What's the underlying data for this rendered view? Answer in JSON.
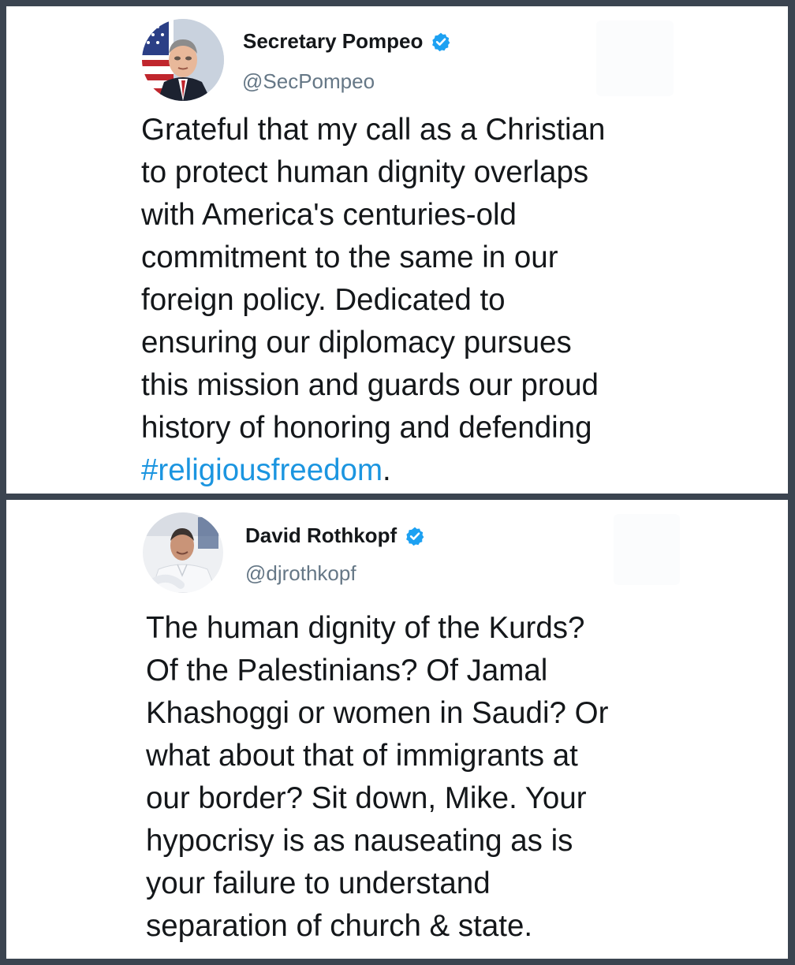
{
  "tweets": [
    {
      "author": {
        "display_name": "Secretary Pompeo",
        "handle": "@SecPompeo",
        "verified": true,
        "avatar_icon": "profile-photo"
      },
      "text_lines": [
        "Grateful that my call as a Christian",
        "to protect human dignity overlaps",
        "with America's centuries-old",
        "commitment to the same in our",
        "foreign policy. Dedicated to",
        "ensuring our diplomacy pursues",
        "this mission and guards our proud",
        "history of honoring and defending"
      ],
      "hashtag": "#religiousfreedom",
      "hashtag_suffix": "."
    },
    {
      "author": {
        "display_name": "David Rothkopf",
        "handle": "@djrothkopf",
        "verified": true,
        "avatar_icon": "profile-photo"
      },
      "text_lines": [
        "The human dignity of the Kurds?",
        "Of the Palestinians?  Of Jamal",
        "Khashoggi or women in Saudi?  Or",
        "what about that of immigrants at",
        "our border?  Sit down, Mike.  Your",
        "hypocrisy is as nauseating as is",
        "your failure to understand",
        "separation of church & state."
      ]
    }
  ],
  "colors": {
    "background_frame": "#3b4450",
    "text_primary": "#14171a",
    "text_secondary": "#657786",
    "verified_badge": "#1da1f2",
    "hashtag_link": "#1b95e0"
  }
}
